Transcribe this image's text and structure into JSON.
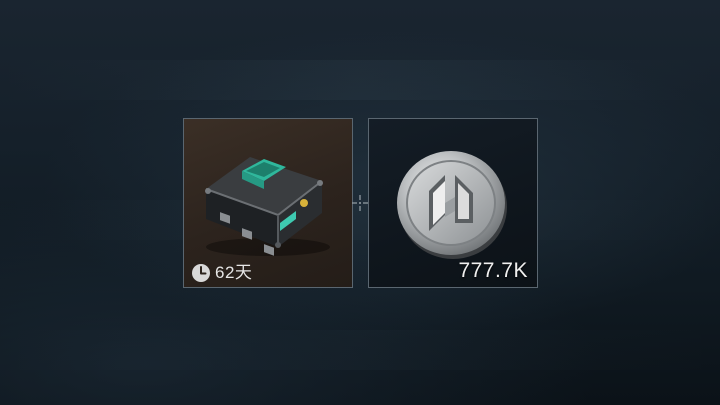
{
  "rewards": [
    {
      "name": "equipment-case",
      "duration": "62天",
      "icons": [
        "clock-icon"
      ],
      "colors": {
        "card_bg": "#2c231d",
        "accent": "#3ec9b0"
      }
    },
    {
      "name": "silver-coin",
      "amount": "777.7K",
      "colors": {
        "card_bg": "#0f161d",
        "coin": "#c8c8c8"
      }
    }
  ],
  "separator_icon": "crosshair-icon"
}
